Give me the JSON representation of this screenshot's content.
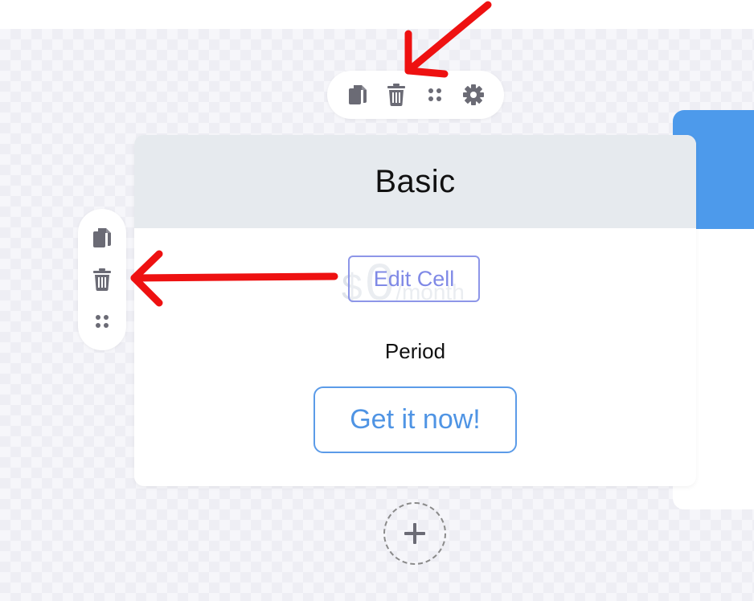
{
  "top_toolbar": {
    "icons": [
      "copy-icon",
      "trash-icon",
      "drag-handle-icon",
      "gear-icon"
    ]
  },
  "left_toolbar": {
    "icons": [
      "copy-icon",
      "trash-icon",
      "drag-handle-icon"
    ]
  },
  "card": {
    "title": "Basic",
    "price_currency": "$",
    "price_amount": "0",
    "price_period": "/month",
    "edit_cell_label": "Edit Cell",
    "period_label": "Period",
    "cta_label": "Get it now!"
  },
  "second_card": {
    "header_color": "#4d9aeb"
  },
  "add_button": {
    "icon": "plus-icon"
  },
  "annotations": {
    "arrow_color": "#ee1111"
  },
  "colors": {
    "accent_blue": "#4f94e4",
    "edit_cell": "#8d96e8",
    "icon_gray": "#6b6b75",
    "header_gray": "#e6eaee"
  }
}
